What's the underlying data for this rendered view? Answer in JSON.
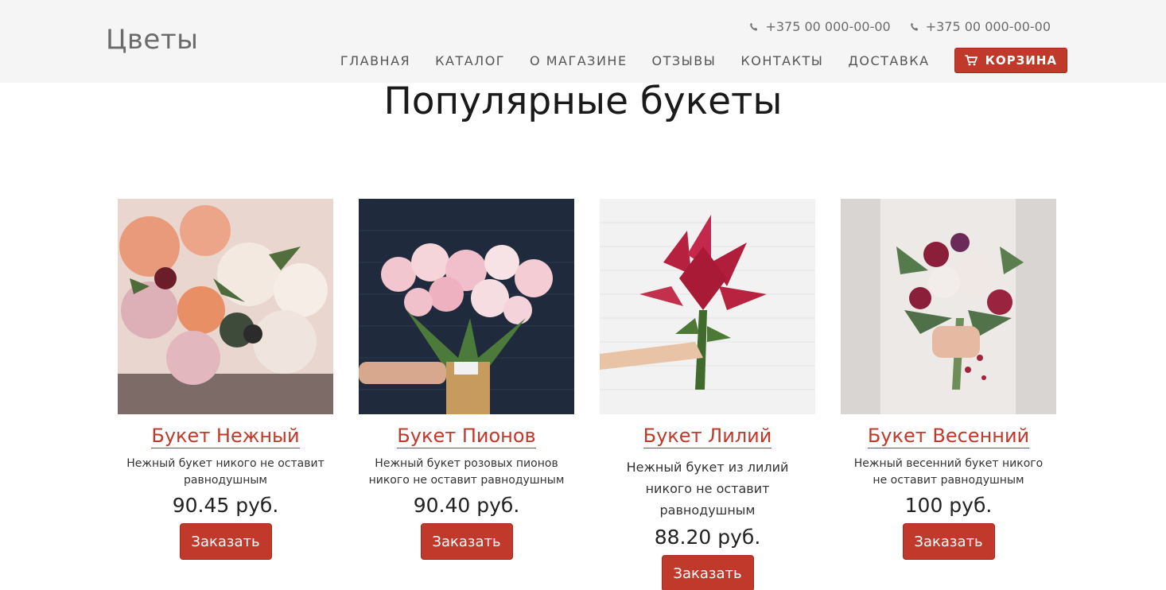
{
  "header": {
    "logo": "Цветы",
    "phones": [
      "+375 00 000-00-00",
      "+375 00 000-00-00"
    ],
    "nav": [
      "ГЛАВНАЯ",
      "КАТАЛОГ",
      "О МАГАЗИНЕ",
      "ОТЗЫВЫ",
      "КОНТАКТЫ",
      "ДОСТАВКА"
    ],
    "cart_label": "КОРЗИНА"
  },
  "section": {
    "title": "Популярные букеты"
  },
  "products": [
    {
      "title": "Букет Нежный",
      "description": "Нежный букет никого не оставит равнодушным",
      "price": "90.45 руб.",
      "button": "Заказать"
    },
    {
      "title": "Букет Пионов",
      "description": "Нежный букет розовых пионов никого не оставит равнодушным",
      "price": "90.40 руб.",
      "button": "Заказать"
    },
    {
      "title": "Букет Лилий",
      "description": "Нежный букет из лилий никого не оставит равнодушным",
      "price": "88.20 руб.",
      "button": "Заказать"
    },
    {
      "title": "Букет Весенний",
      "description": "Нежный весенний букет никого не оставит равнодушным",
      "price": "100 руб.",
      "button": "Заказать"
    }
  ],
  "colors": {
    "accent": "#c0392b",
    "header_bg": "#f5f5f5"
  },
  "icons": [
    "phone-icon",
    "cart-icon"
  ]
}
